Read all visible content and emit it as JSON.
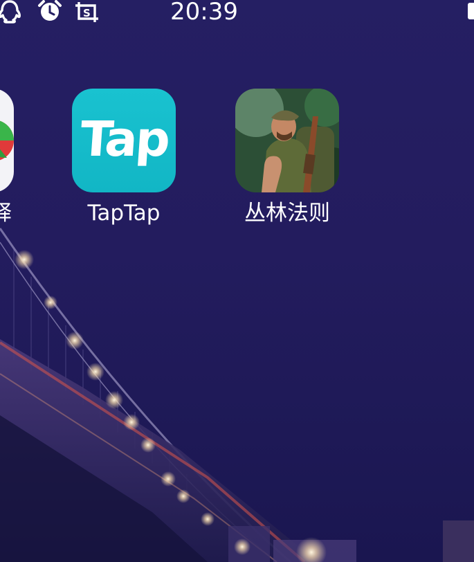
{
  "status_bar": {
    "time": "20:39",
    "icons": [
      "qq-icon",
      "alarm-icon",
      "screenshot-icon"
    ]
  },
  "apps": [
    {
      "label": "驿",
      "icon": "partial-app-icon",
      "accent": "#f3f3f7"
    },
    {
      "label": "TapTap",
      "icon_text": "Tap",
      "icon": "taptap-icon",
      "accent": "#15bccb"
    },
    {
      "label": "丛林法则",
      "icon": "jungle-law-game-icon",
      "accent": "#2e5a3a"
    }
  ],
  "wallpaper": {
    "subject": "bridge-at-night",
    "colors": {
      "sky": "#251f63",
      "lights": "#ffe9c4"
    }
  }
}
